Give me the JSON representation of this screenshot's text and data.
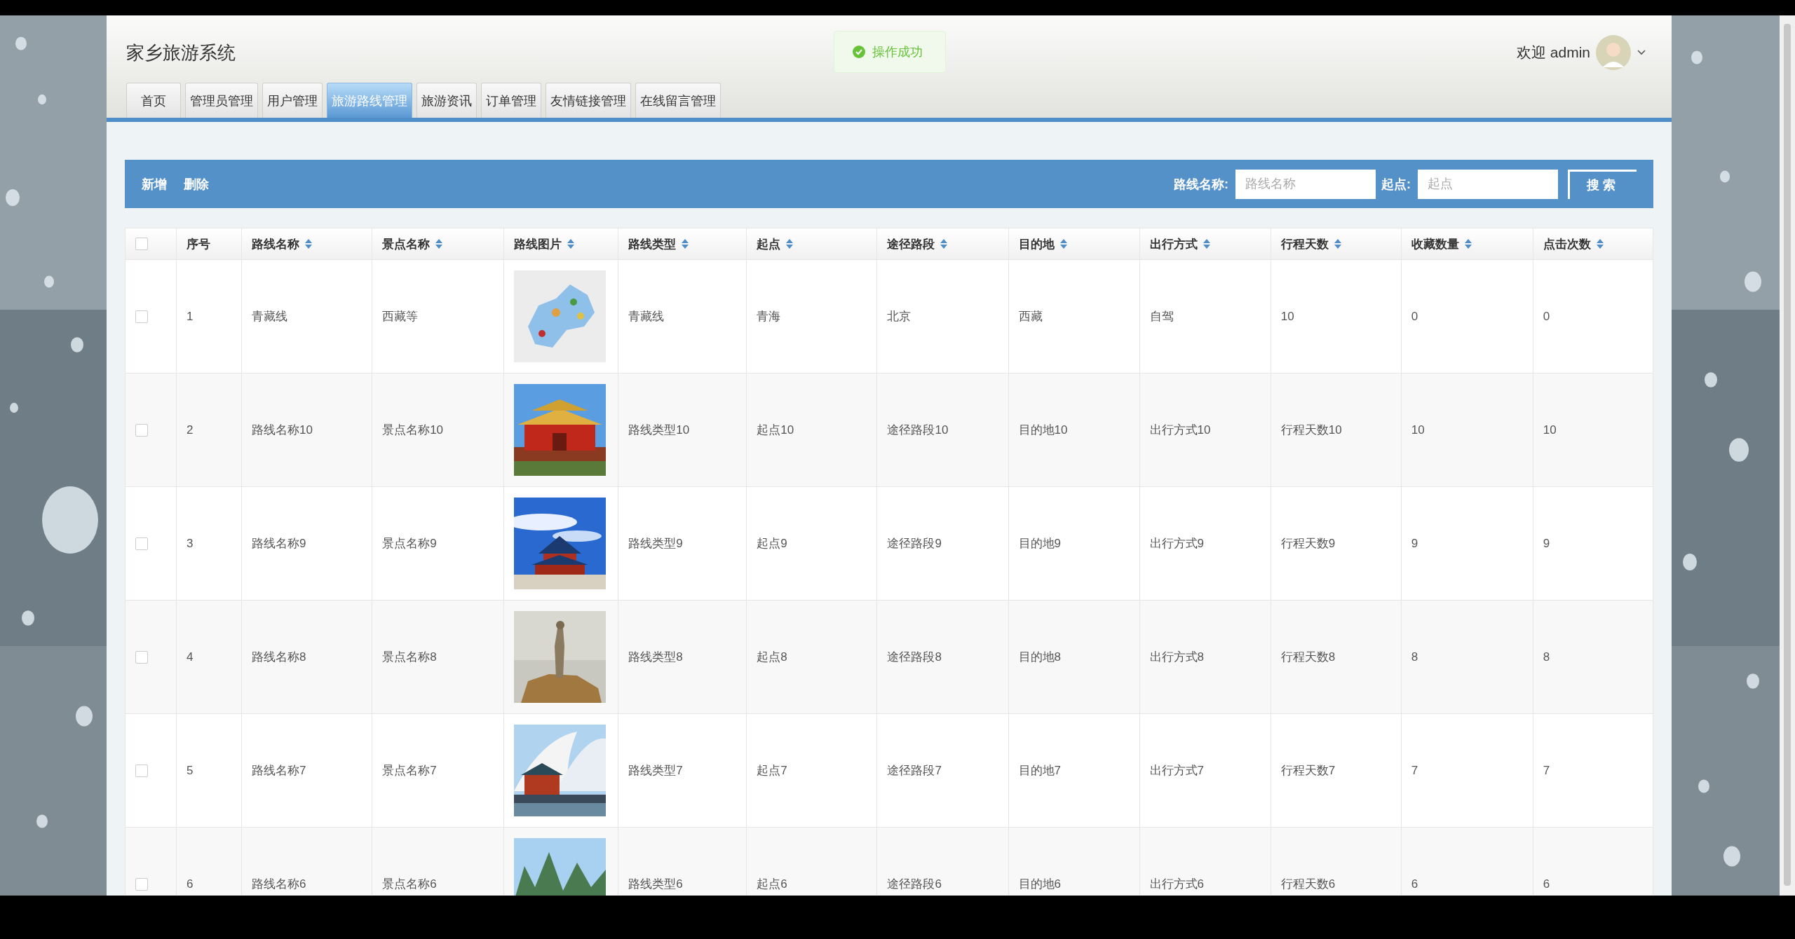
{
  "header": {
    "title": "家乡旅游系统",
    "greeting": "欢迎 admin"
  },
  "tabs": [
    {
      "label": "首页",
      "selected": false
    },
    {
      "label": "管理员管理",
      "selected": false
    },
    {
      "label": "用户管理",
      "selected": false
    },
    {
      "label": "旅游路线管理",
      "selected": true
    },
    {
      "label": "旅游资讯",
      "selected": false
    },
    {
      "label": "订单管理",
      "selected": false
    },
    {
      "label": "友情链接管理",
      "selected": false
    },
    {
      "label": "在线留言管理",
      "selected": false
    }
  ],
  "toast": {
    "message": "操作成功"
  },
  "toolbar": {
    "actions": [
      "新增",
      "删除"
    ],
    "filters": [
      {
        "label": "路线名称:",
        "placeholder": "路线名称"
      },
      {
        "label": "起点:",
        "placeholder": "起点"
      }
    ],
    "search_button": "搜 索"
  },
  "table": {
    "select_all_checked": false,
    "columns": [
      {
        "label": "序号",
        "sortable": false
      },
      {
        "label": "路线名称",
        "sortable": true
      },
      {
        "label": "景点名称",
        "sortable": true
      },
      {
        "label": "路线图片",
        "sortable": true
      },
      {
        "label": "路线类型",
        "sortable": true
      },
      {
        "label": "起点",
        "sortable": true
      },
      {
        "label": "途径路段",
        "sortable": true
      },
      {
        "label": "目的地",
        "sortable": true
      },
      {
        "label": "出行方式",
        "sortable": true
      },
      {
        "label": "行程天数",
        "sortable": true
      },
      {
        "label": "收藏数量",
        "sortable": true
      },
      {
        "label": "点击次数",
        "sortable": true
      }
    ],
    "rows": [
      {
        "checked": false,
        "cells": [
          {
            "kind": "text",
            "text": "1"
          },
          {
            "kind": "text",
            "text": "青藏线"
          },
          {
            "kind": "text",
            "text": "西藏等"
          },
          {
            "kind": "picture"
          },
          {
            "kind": "text",
            "text": "青藏线"
          },
          {
            "kind": "text",
            "text": "青海"
          },
          {
            "kind": "text",
            "text": "北京"
          },
          {
            "kind": "text",
            "text": "西藏"
          },
          {
            "kind": "text",
            "text": "自驾"
          },
          {
            "kind": "text",
            "text": "10"
          },
          {
            "kind": "text",
            "text": "0"
          },
          {
            "kind": "text",
            "text": "0"
          }
        ]
      },
      {
        "checked": false,
        "cells": [
          {
            "kind": "text",
            "text": "2"
          },
          {
            "kind": "text",
            "text": "路线名称10"
          },
          {
            "kind": "text",
            "text": "景点名称10"
          },
          {
            "kind": "picture"
          },
          {
            "kind": "text",
            "text": "路线类型10"
          },
          {
            "kind": "text",
            "text": "起点10"
          },
          {
            "kind": "text",
            "text": "途径路段10"
          },
          {
            "kind": "text",
            "text": "目的地10"
          },
          {
            "kind": "text",
            "text": "出行方式10"
          },
          {
            "kind": "text",
            "text": "行程天数10"
          },
          {
            "kind": "text",
            "text": "10"
          },
          {
            "kind": "text",
            "text": "10"
          }
        ]
      },
      {
        "checked": false,
        "cells": [
          {
            "kind": "text",
            "text": "3"
          },
          {
            "kind": "text",
            "text": "路线名称9"
          },
          {
            "kind": "text",
            "text": "景点名称9"
          },
          {
            "kind": "picture"
          },
          {
            "kind": "text",
            "text": "路线类型9"
          },
          {
            "kind": "text",
            "text": "起点9"
          },
          {
            "kind": "text",
            "text": "途径路段9"
          },
          {
            "kind": "text",
            "text": "目的地9"
          },
          {
            "kind": "text",
            "text": "出行方式9"
          },
          {
            "kind": "text",
            "text": "行程天数9"
          },
          {
            "kind": "text",
            "text": "9"
          },
          {
            "kind": "text",
            "text": "9"
          }
        ]
      },
      {
        "checked": false,
        "cells": [
          {
            "kind": "text",
            "text": "4"
          },
          {
            "kind": "text",
            "text": "路线名称8"
          },
          {
            "kind": "text",
            "text": "景点名称8"
          },
          {
            "kind": "picture"
          },
          {
            "kind": "text",
            "text": "路线类型8"
          },
          {
            "kind": "text",
            "text": "起点8"
          },
          {
            "kind": "text",
            "text": "途径路段8"
          },
          {
            "kind": "text",
            "text": "目的地8"
          },
          {
            "kind": "text",
            "text": "出行方式8"
          },
          {
            "kind": "text",
            "text": "行程天数8"
          },
          {
            "kind": "text",
            "text": "8"
          },
          {
            "kind": "text",
            "text": "8"
          }
        ]
      },
      {
        "checked": false,
        "cells": [
          {
            "kind": "text",
            "text": "5"
          },
          {
            "kind": "text",
            "text": "路线名称7"
          },
          {
            "kind": "text",
            "text": "景点名称7"
          },
          {
            "kind": "picture"
          },
          {
            "kind": "text",
            "text": "路线类型7"
          },
          {
            "kind": "text",
            "text": "起点7"
          },
          {
            "kind": "text",
            "text": "途径路段7"
          },
          {
            "kind": "text",
            "text": "目的地7"
          },
          {
            "kind": "text",
            "text": "出行方式7"
          },
          {
            "kind": "text",
            "text": "行程天数7"
          },
          {
            "kind": "text",
            "text": "7"
          },
          {
            "kind": "text",
            "text": "7"
          }
        ]
      },
      {
        "checked": false,
        "cells": [
          {
            "kind": "text",
            "text": "6"
          },
          {
            "kind": "text",
            "text": "路线名称6"
          },
          {
            "kind": "text",
            "text": "景点名称6"
          },
          {
            "kind": "picture"
          },
          {
            "kind": "text",
            "text": "路线类型6"
          },
          {
            "kind": "text",
            "text": "起点6"
          },
          {
            "kind": "text",
            "text": "途径路段6"
          },
          {
            "kind": "text",
            "text": "目的地6"
          },
          {
            "kind": "text",
            "text": "出行方式6"
          },
          {
            "kind": "text",
            "text": "行程天数6"
          },
          {
            "kind": "text",
            "text": "6"
          },
          {
            "kind": "text",
            "text": "6"
          }
        ]
      }
    ]
  }
}
